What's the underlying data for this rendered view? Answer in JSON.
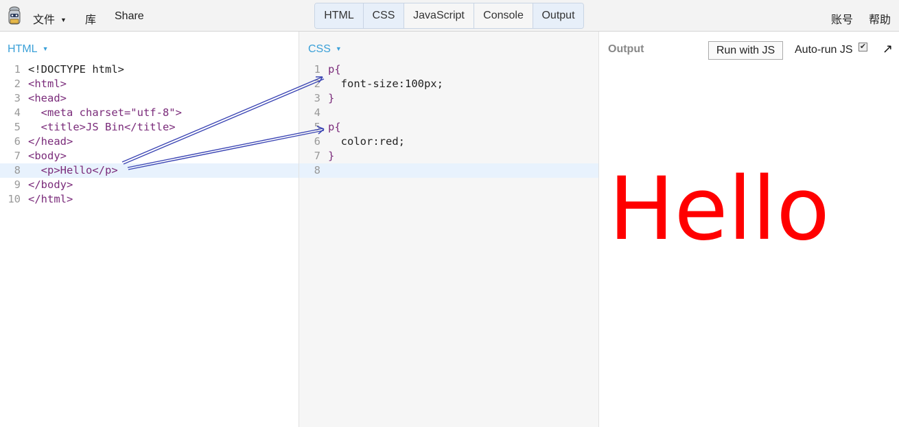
{
  "topbar": {
    "file_label": "文件",
    "library_label": "库",
    "share_label": "Share",
    "account_label": "账号",
    "help_label": "帮助",
    "tabs": [
      {
        "label": "HTML",
        "active": true
      },
      {
        "label": "CSS",
        "active": true
      },
      {
        "label": "JavaScript",
        "active": false
      },
      {
        "label": "Console",
        "active": false
      },
      {
        "label": "Output",
        "active": true
      }
    ]
  },
  "html_panel": {
    "label": "HTML",
    "active_line": 8,
    "lines": [
      "<!DOCTYPE html>",
      "<html>",
      "<head>",
      "  <meta charset=\"utf-8\">",
      "  <title>JS Bin</title>",
      "</head>",
      "<body>",
      "  <p>Hello</p>",
      "</body>",
      "</html>"
    ]
  },
  "css_panel": {
    "label": "CSS",
    "active_line": 8,
    "lines": [
      "p{",
      "  font-size:100px;",
      "}",
      "",
      "p{",
      "  color:red;",
      "}",
      ""
    ]
  },
  "output_panel": {
    "label": "Output",
    "run_button": "Run with JS",
    "autorun_label": "Auto-run JS",
    "autorun_checked": true,
    "rendered_text": "Hello",
    "rendered_color": "#ff0000"
  },
  "colors": {
    "accent": "#3aa0d8",
    "annotation_arrow": "#3c46b4"
  },
  "icons": {
    "logo": "jsbin-logo-icon",
    "popout": "popout-arrow-icon",
    "caret": "caret-down-icon"
  }
}
